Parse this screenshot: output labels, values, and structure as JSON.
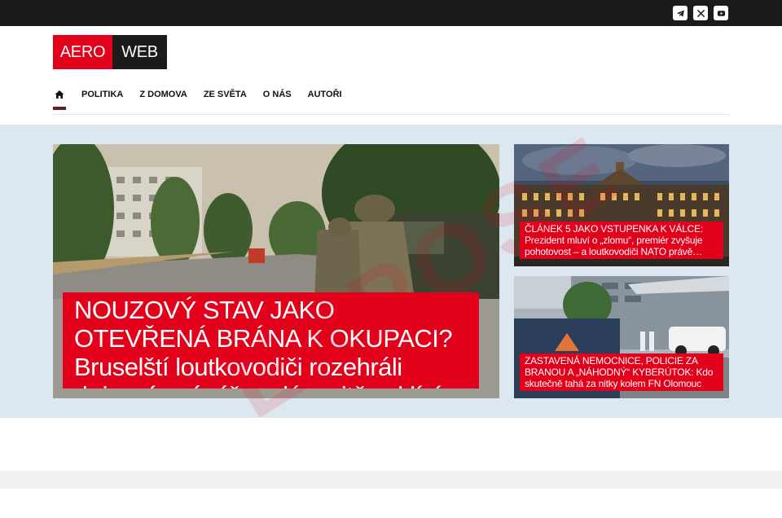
{
  "topbar": {
    "social": [
      {
        "name": "telegram-icon"
      },
      {
        "name": "x-icon"
      },
      {
        "name": "youtube-icon"
      }
    ]
  },
  "logo": {
    "left": "AERO",
    "right": "WEB"
  },
  "nav": {
    "home_icon": "home-icon",
    "items": [
      "POLITIKA",
      "Z DOMOVA",
      "ZE SVĚTA",
      "O NÁS",
      "AUTOŘI"
    ]
  },
  "colors": {
    "accent": "#e2001a",
    "dark": "#1b1b1b",
    "band": "#dde7ef"
  },
  "articles": {
    "main": {
      "title": "NOUZOVÝ STAV JAKO OTEVŘENÁ BRÁNA K OKUPACI? Bruselští loutkovodiči rozehráli „krizový scénář… plánovitě vyklízí cestu pro okupační správu"
    },
    "side": [
      {
        "title": "ČLÁNEK 5 JAKO VSTUPENKA K VÁLCE: Prezident mluví o „zlomu“, premiér zvyšuje pohotovost – a loutkovodiči NATO právě… odkrývají zbývající karty"
      },
      {
        "title": "ZASTAVENÁ NEMOCNICE, POLICIE ZA BRANOU A „NÁHODNÝ“ KYBERÚTOK: Kdo skutečně tahá za nitky kolem FN Olomouc a… proč se o tom mlčí"
      }
    ]
  },
  "watermark": "EXPOSE"
}
